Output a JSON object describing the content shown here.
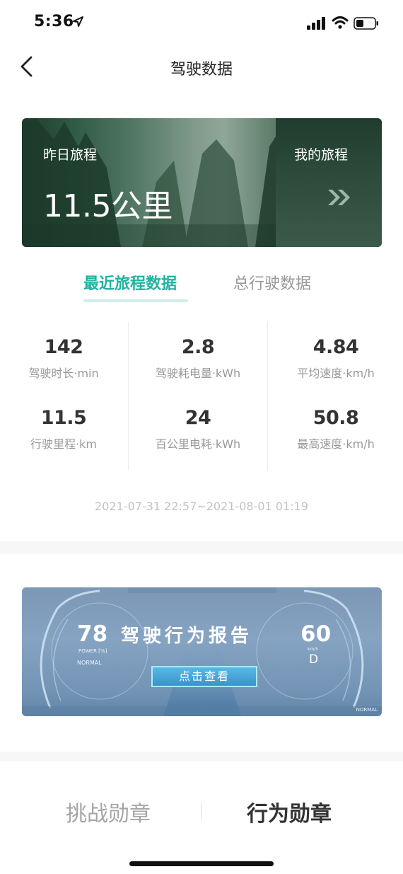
{
  "status_bar": {
    "time": "5:36",
    "icons": [
      "location-arrow-icon",
      "signal-icon",
      "wifi-icon",
      "battery-icon"
    ]
  },
  "nav": {
    "back_icon": "chevron-left-icon",
    "title": "驾驶数据"
  },
  "trip_banner": {
    "left_label": "昨日旅程",
    "value": "11.5公里",
    "right_label": "我的旅程",
    "right_icon": "double-chevron-right-icon"
  },
  "tabs": {
    "active": "最近旅程数据",
    "inactive": "总行驶数据",
    "accent_color": "#1fb3a0"
  },
  "stats": [
    {
      "value": "142",
      "label": "驾驶时长·min"
    },
    {
      "value": "2.8",
      "label": "驾驶耗电量·kWh"
    },
    {
      "value": "4.84",
      "label": "平均速度·km/h"
    },
    {
      "value": "11.5",
      "label": "行驶里程·km"
    },
    {
      "value": "24",
      "label": "百公里电耗·kWh"
    },
    {
      "value": "50.8",
      "label": "最高速度·km/h"
    }
  ],
  "date_range": "2021-07-31 22:57~2021-08-01 01:19",
  "report_banner": {
    "left_speed": "78",
    "left_power_label": "POWER [%]",
    "left_mode": "NORMAL",
    "title": "驾驶行为报告",
    "right_speed": "60",
    "right_unit": "km/h",
    "right_gear": "D",
    "button": "点击查看",
    "bottom_mode": "NORMAL"
  },
  "badge_tabs": {
    "inactive": "挑战勋章",
    "active": "行为勋章"
  }
}
